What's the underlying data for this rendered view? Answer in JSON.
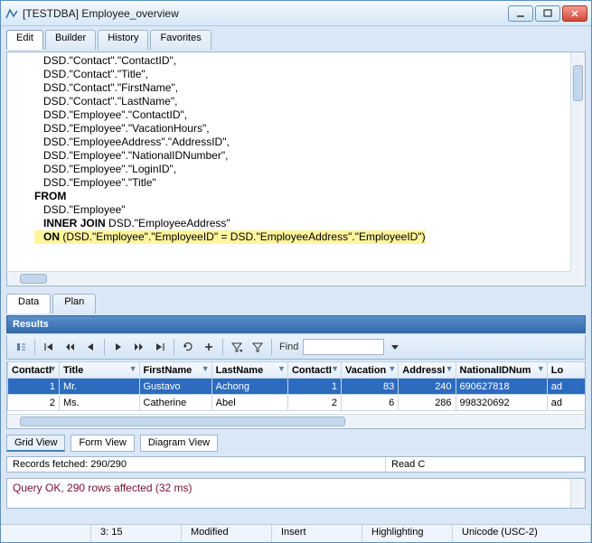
{
  "window": {
    "title": "[TESTDBA] Employee_overview"
  },
  "main_tabs": {
    "edit": "Edit",
    "builder": "Builder",
    "history": "History",
    "favorites": "Favorites"
  },
  "editor": {
    "lines": [
      "   DSD.\"Contact\".\"ContactID\",",
      "   DSD.\"Contact\".\"Title\",",
      "   DSD.\"Contact\".\"FirstName\",",
      "   DSD.\"Contact\".\"LastName\",",
      "   DSD.\"Employee\".\"ContactID\",",
      "   DSD.\"Employee\".\"VacationHours\",",
      "   DSD.\"EmployeeAddress\".\"AddressID\",",
      "   DSD.\"Employee\".\"NationalIDNumber\",",
      "   DSD.\"Employee\".\"LoginID\",",
      "   DSD.\"Employee\".\"Title\"",
      "FROM",
      "   DSD.\"Employee\"",
      "   INNER JOIN DSD.\"EmployeeAddress\"",
      "   ON (DSD.\"Employee\".\"EmployeeID\" = DSD.\"EmployeeAddress\".\"EmployeeID\")"
    ]
  },
  "results_tabs": {
    "data": "Data",
    "plan": "Plan"
  },
  "results_header": "Results",
  "find_label": "Find",
  "find_value": "",
  "columns": [
    "ContactI",
    "Title",
    "FirstName",
    "LastName",
    "ContactI",
    "Vacation",
    "AddressI",
    "NationalIDNum",
    "Lo"
  ],
  "rows": [
    {
      "n": "1",
      "title": "Mr.",
      "first": "Gustavo",
      "last": "Achong",
      "cid": "1",
      "vac": "83",
      "addr": "240",
      "nat": "690627818",
      "lo": "ad"
    },
    {
      "n": "2",
      "title": "Ms.",
      "first": "Catherine",
      "last": "Abel",
      "cid": "2",
      "vac": "6",
      "addr": "286",
      "nat": "998320692",
      "lo": "ad"
    }
  ],
  "view_tabs": {
    "grid": "Grid View",
    "form": "Form View",
    "diagram": "Diagram View"
  },
  "fetch_status": {
    "msg": "Records fetched: 290/290",
    "readc": "Read C"
  },
  "message": "Query OK, 290 rows affected (32 ms)",
  "statusbar": {
    "pos": "3:  15",
    "modified": "Modified",
    "insert": "Insert",
    "highlighting": "Highlighting",
    "encoding": "Unicode (USC-2)"
  }
}
